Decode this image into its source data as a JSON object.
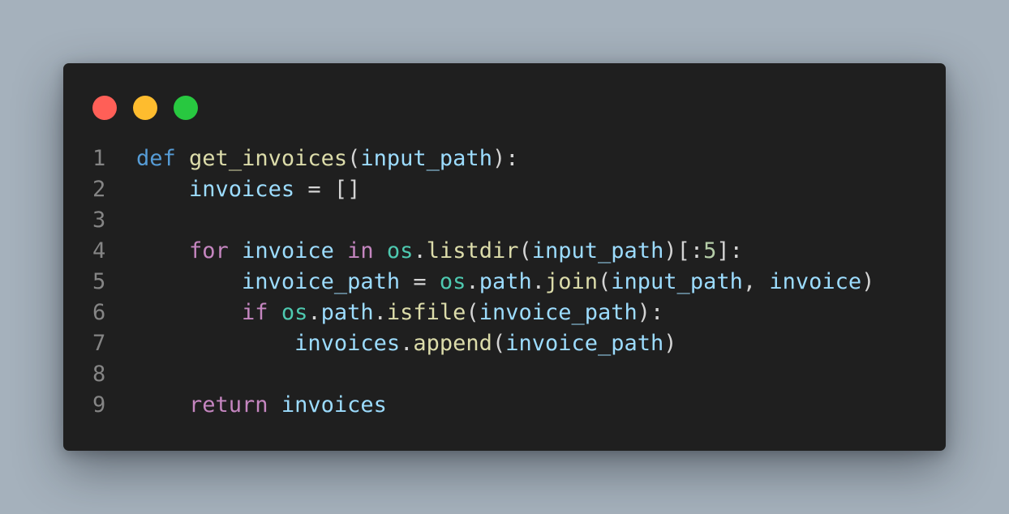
{
  "window": {
    "controls": {
      "close_color": "#ff5f57",
      "minimize_color": "#febc2e",
      "maximize_color": "#28c840"
    }
  },
  "code": {
    "language": "python",
    "lines": [
      {
        "number": "1",
        "tokens": [
          {
            "text": "def",
            "kind": "kw1"
          },
          {
            "text": " ",
            "kind": "op"
          },
          {
            "text": "get_invoices",
            "kind": "fn"
          },
          {
            "text": "(",
            "kind": "op"
          },
          {
            "text": "input_path",
            "kind": "var"
          },
          {
            "text": "):",
            "kind": "op"
          }
        ]
      },
      {
        "number": "2",
        "tokens": [
          {
            "text": "    ",
            "kind": "op"
          },
          {
            "text": "invoices",
            "kind": "var"
          },
          {
            "text": " = []",
            "kind": "op"
          }
        ]
      },
      {
        "number": "3",
        "tokens": []
      },
      {
        "number": "4",
        "tokens": [
          {
            "text": "    ",
            "kind": "op"
          },
          {
            "text": "for",
            "kind": "kw2"
          },
          {
            "text": " ",
            "kind": "op"
          },
          {
            "text": "invoice",
            "kind": "var"
          },
          {
            "text": " ",
            "kind": "op"
          },
          {
            "text": "in",
            "kind": "kw2"
          },
          {
            "text": " ",
            "kind": "op"
          },
          {
            "text": "os",
            "kind": "mod"
          },
          {
            "text": ".",
            "kind": "op"
          },
          {
            "text": "listdir",
            "kind": "fn"
          },
          {
            "text": "(",
            "kind": "op"
          },
          {
            "text": "input_path",
            "kind": "var"
          },
          {
            "text": ")[:",
            "kind": "op"
          },
          {
            "text": "5",
            "kind": "num"
          },
          {
            "text": "]:",
            "kind": "op"
          }
        ]
      },
      {
        "number": "5",
        "tokens": [
          {
            "text": "        ",
            "kind": "op"
          },
          {
            "text": "invoice_path",
            "kind": "var"
          },
          {
            "text": " = ",
            "kind": "op"
          },
          {
            "text": "os",
            "kind": "mod"
          },
          {
            "text": ".",
            "kind": "op"
          },
          {
            "text": "path",
            "kind": "var"
          },
          {
            "text": ".",
            "kind": "op"
          },
          {
            "text": "join",
            "kind": "fn"
          },
          {
            "text": "(",
            "kind": "op"
          },
          {
            "text": "input_path",
            "kind": "var"
          },
          {
            "text": ", ",
            "kind": "op"
          },
          {
            "text": "invoice",
            "kind": "var"
          },
          {
            "text": ")",
            "kind": "op"
          }
        ]
      },
      {
        "number": "6",
        "tokens": [
          {
            "text": "        ",
            "kind": "op"
          },
          {
            "text": "if",
            "kind": "kw2"
          },
          {
            "text": " ",
            "kind": "op"
          },
          {
            "text": "os",
            "kind": "mod"
          },
          {
            "text": ".",
            "kind": "op"
          },
          {
            "text": "path",
            "kind": "var"
          },
          {
            "text": ".",
            "kind": "op"
          },
          {
            "text": "isfile",
            "kind": "fn"
          },
          {
            "text": "(",
            "kind": "op"
          },
          {
            "text": "invoice_path",
            "kind": "var"
          },
          {
            "text": "):",
            "kind": "op"
          }
        ]
      },
      {
        "number": "7",
        "tokens": [
          {
            "text": "            ",
            "kind": "op"
          },
          {
            "text": "invoices",
            "kind": "var"
          },
          {
            "text": ".",
            "kind": "op"
          },
          {
            "text": "append",
            "kind": "fn"
          },
          {
            "text": "(",
            "kind": "op"
          },
          {
            "text": "invoice_path",
            "kind": "var"
          },
          {
            "text": ")",
            "kind": "op"
          }
        ]
      },
      {
        "number": "8",
        "tokens": []
      },
      {
        "number": "9",
        "tokens": [
          {
            "text": "    ",
            "kind": "op"
          },
          {
            "text": "return",
            "kind": "kw2"
          },
          {
            "text": " ",
            "kind": "op"
          },
          {
            "text": "invoices",
            "kind": "var"
          }
        ]
      }
    ]
  }
}
